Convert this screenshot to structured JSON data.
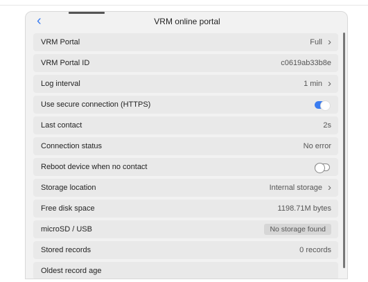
{
  "header": {
    "title": "VRM online portal",
    "back_icon": "chevron-left-icon"
  },
  "rows": [
    {
      "label": "VRM Portal",
      "value": "Full"
    },
    {
      "label": "VRM Portal ID",
      "value": "c0619ab33b8e"
    },
    {
      "label": "Log interval",
      "value": "1 min"
    },
    {
      "label": "Use secure connection (HTTPS)",
      "toggle": true
    },
    {
      "label": "Last contact",
      "value": "2s"
    },
    {
      "label": "Connection status",
      "value": "No error"
    },
    {
      "label": "Reboot device when no contact",
      "toggle": false
    },
    {
      "label": "Storage location",
      "value": "Internal storage"
    },
    {
      "label": "Free disk space",
      "value": "1198.71M bytes"
    },
    {
      "label": "microSD / USB",
      "value": "No storage found"
    },
    {
      "label": "Stored records",
      "value": "0 records"
    },
    {
      "label": "Oldest record age",
      "value": ""
    }
  ],
  "colors": {
    "accent": "#3a7cf0",
    "row_bg": "#e9e9e9",
    "panel_bg": "#f2f2f2"
  }
}
